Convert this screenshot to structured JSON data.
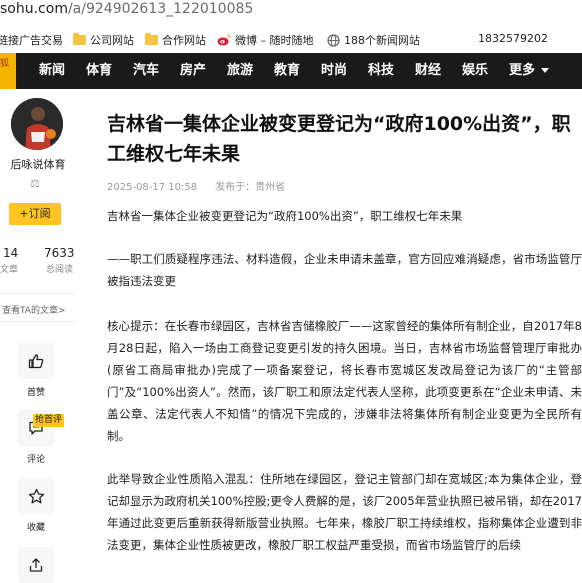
{
  "browser": {
    "url_host": "sohu.com",
    "url_path": "/a/924902613_122010085"
  },
  "bookmarks": [
    {
      "label": "链接广告交易",
      "icon": null
    },
    {
      "label": "公司网站",
      "icon": "folder-icon"
    },
    {
      "label": "合作网站",
      "icon": "folder-icon"
    },
    {
      "label": "微博 – 随时随地",
      "icon": "weibo-icon"
    },
    {
      "label": "188个新闻网站",
      "icon": "globe-icon"
    },
    {
      "label": "1832579202",
      "icon": null
    }
  ],
  "nav": {
    "logo_text": "狐",
    "items": [
      "新闻",
      "体育",
      "汽车",
      "房产",
      "旅游",
      "教育",
      "时尚",
      "科技",
      "财经",
      "娱乐"
    ],
    "more_label": "更多"
  },
  "author": {
    "name": "后咏说体育",
    "badge": "⚖",
    "follow_label": "+订阅",
    "stats": [
      {
        "value": "14",
        "label": "文章"
      },
      {
        "value": "7633",
        "label": "总阅读"
      }
    ],
    "more_articles_label": "查看TA的文章>"
  },
  "actions": {
    "like_label": "首赞",
    "comment_label": "评论",
    "hot_badge": "抢首评",
    "favorite_label": "收藏"
  },
  "article": {
    "title": "吉林省一集体企业被变更登记为“政府100%出资”，职工维权七年未果",
    "date": "2025-08-17 10:58",
    "source": "发布于：贵州省",
    "paragraphs": [
      "吉林省一集体企业被变更登记为“政府100%出资”，职工维权七年未果",
      "——职工们质疑程序违法、材料造假，企业未申请未盖章，官方回应难消疑虑，省市场监管厅被指违法变更",
      "核心提示：在长春市绿园区，吉林省吉储橡胶厂——这家曾经的集体所有制企业，自2017年8月28日起，陷入一场由工商登记变更引发的持久困境。当日，吉林省市场监督管理厅审批办(原省工商局审批办)完成了一项备案登记，将长春市宽城区发改局登记为该厂的“主管部门”及“100%出资人”。然而，该厂职工和原法定代表人坚称，此项变更系在“企业未申请、未盖公章、法定代表人不知情”的情况下完成的，涉嫌非法将集体所有制企业变更为全民所有制。",
      "此举导致企业性质陷入混乱：住所地在绿园区，登记主管部门却在宽城区;本为集体企业，登记却显示为政府机关100%控股;更令人费解的是，该厂2005年营业执照已被吊销，却在2017年通过此变更后重新获得新版营业执照。七年来，橡胶厂职工持续维权，指称集体企业遭到非法变更，集体企业性质被更改，橡胶厂职工权益严重受损，而省市场监管厅的后续"
    ]
  }
}
